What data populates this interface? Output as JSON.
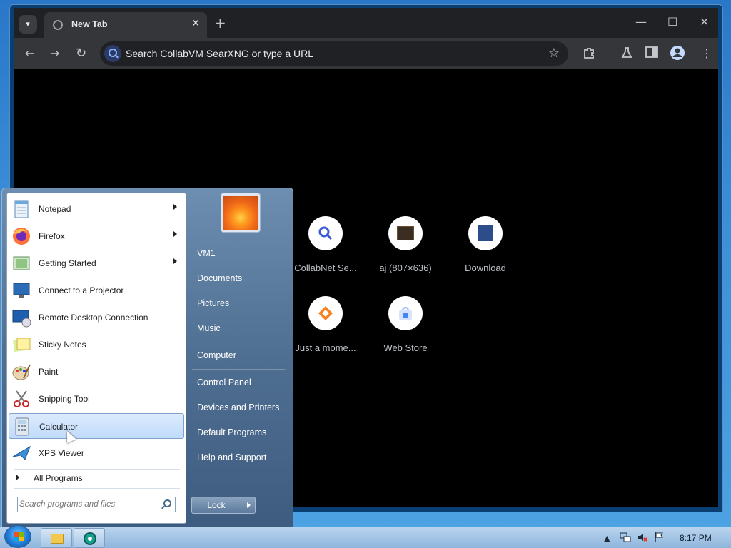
{
  "browser": {
    "tab": {
      "title": "New Tab",
      "close": "✕"
    },
    "new_tab": "+",
    "window": {
      "minimize": "—",
      "maximize": "☐",
      "close": "✕"
    },
    "toolbar": {
      "back": "←",
      "forward": "→",
      "reload": "↻",
      "url_placeholder": "Search CollabVM SearXNG or type a URL"
    },
    "shortcuts": [
      {
        "label": "CollabNet Se...",
        "icon": "search-icon"
      },
      {
        "label": "aj (807×636)",
        "icon": "thumbnail-icon"
      },
      {
        "label": "Download",
        "icon": "thumbnail-icon"
      },
      {
        "label": "Just a mome...",
        "icon": "diamond-icon"
      },
      {
        "label": "Web Store",
        "icon": "web-store-icon"
      }
    ]
  },
  "start_menu": {
    "programs": [
      {
        "label": "Notepad",
        "icon": "notepad-icon",
        "submenu": true
      },
      {
        "label": "Firefox",
        "icon": "firefox-icon",
        "submenu": true
      },
      {
        "label": "Getting Started",
        "icon": "getting-started-icon",
        "submenu": true
      },
      {
        "label": "Connect to a Projector",
        "icon": "projector-icon",
        "submenu": false
      },
      {
        "label": "Remote Desktop Connection",
        "icon": "remote-desktop-icon",
        "submenu": false
      },
      {
        "label": "Sticky Notes",
        "icon": "sticky-notes-icon",
        "submenu": false
      },
      {
        "label": "Paint",
        "icon": "paint-icon",
        "submenu": false
      },
      {
        "label": "Snipping Tool",
        "icon": "snipping-tool-icon",
        "submenu": false
      },
      {
        "label": "Calculator",
        "icon": "calculator-icon",
        "submenu": false,
        "selected": true
      },
      {
        "label": "XPS Viewer",
        "icon": "xps-viewer-icon",
        "submenu": false
      }
    ],
    "all_programs": "All Programs",
    "search_placeholder": "Search programs and files",
    "right_links": [
      "VM1",
      "Documents",
      "Pictures",
      "Music",
      "Computer",
      "Control Panel",
      "Devices and Printers",
      "Default Programs",
      "Help and Support"
    ],
    "lock_label": "Lock"
  },
  "taskbar": {
    "clock": "8:17 PM",
    "tray_icons": [
      "show-hidden-icon",
      "network-icon",
      "volume-muted-icon",
      "action-center-flag-icon"
    ]
  }
}
